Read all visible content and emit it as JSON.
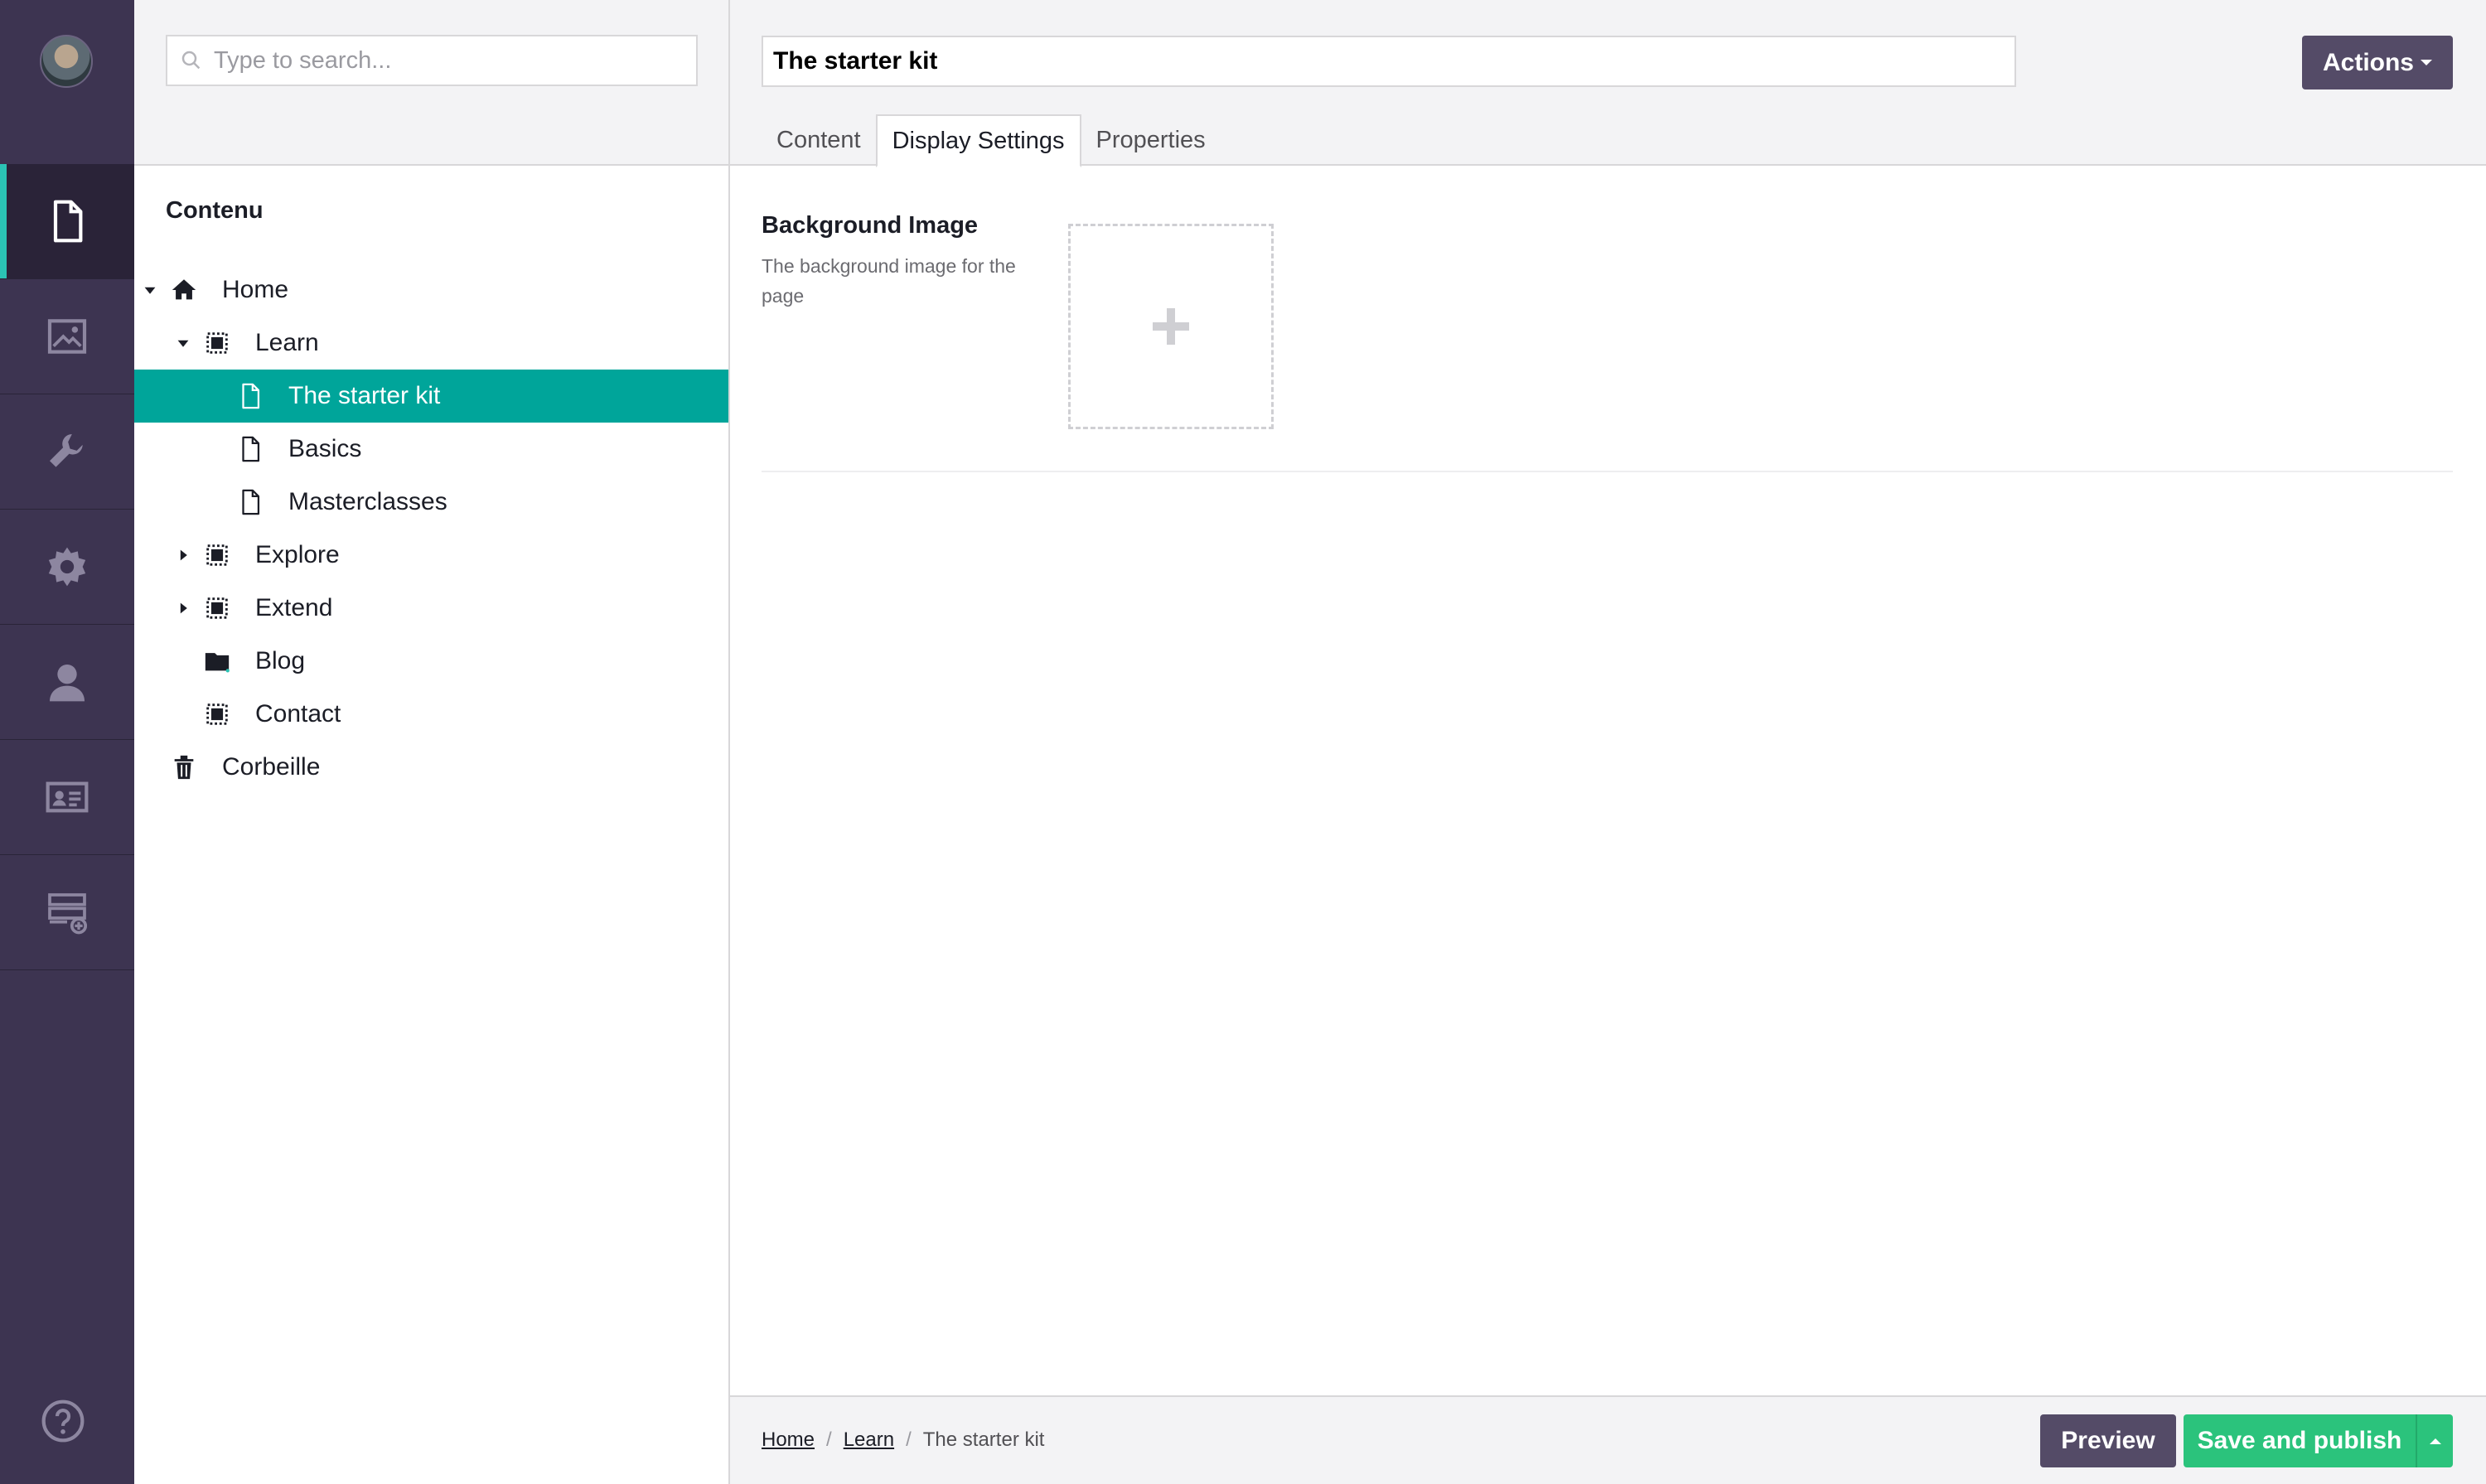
{
  "rail": {
    "sections": [
      {
        "name": "content",
        "icon": "document-icon",
        "active": true
      },
      {
        "name": "media",
        "icon": "image-icon",
        "active": false
      },
      {
        "name": "settings",
        "icon": "wrench-icon",
        "active": false
      },
      {
        "name": "packages",
        "icon": "gear-icon",
        "active": false
      },
      {
        "name": "users",
        "icon": "user-icon",
        "active": false
      },
      {
        "name": "members",
        "icon": "id-card-icon",
        "active": false
      },
      {
        "name": "forms",
        "icon": "forms-icon",
        "active": false
      }
    ],
    "help_icon": "help-icon",
    "accent": "#2bc3b4",
    "background": "#3d3451"
  },
  "tree": {
    "search_placeholder": "Type to search...",
    "heading": "Contenu",
    "items": [
      {
        "label": "Home",
        "icon": "home-icon",
        "depth": 0,
        "caret": "expanded",
        "selected": false
      },
      {
        "label": "Learn",
        "icon": "section-icon",
        "depth": 1,
        "caret": "expanded",
        "selected": false
      },
      {
        "label": "The starter kit",
        "icon": "page-icon",
        "depth": 2,
        "caret": "none",
        "selected": true
      },
      {
        "label": "Basics",
        "icon": "page-icon",
        "depth": 2,
        "caret": "none",
        "selected": false
      },
      {
        "label": "Masterclasses",
        "icon": "page-icon",
        "depth": 2,
        "caret": "none",
        "selected": false
      },
      {
        "label": "Explore",
        "icon": "section-icon",
        "depth": 1,
        "caret": "collapsed",
        "selected": false
      },
      {
        "label": "Extend",
        "icon": "section-icon",
        "depth": 1,
        "caret": "collapsed",
        "selected": false
      },
      {
        "label": "Blog",
        "icon": "folder-icon",
        "depth": 1,
        "caret": "none",
        "selected": false
      },
      {
        "label": "Contact",
        "icon": "section-icon",
        "depth": 1,
        "caret": "none",
        "selected": false
      },
      {
        "label": "Corbeille",
        "icon": "trash-icon",
        "depth": 0,
        "caret": "none",
        "selected": false
      }
    ],
    "selected_color": "#00a59a"
  },
  "editor": {
    "name_value": "The starter kit",
    "actions_label": "Actions",
    "tabs": [
      {
        "label": "Content",
        "active": false
      },
      {
        "label": "Display Settings",
        "active": true
      },
      {
        "label": "Properties",
        "active": false
      }
    ],
    "property": {
      "label": "Background Image",
      "description": "The background image for the page"
    }
  },
  "footer": {
    "breadcrumb": [
      "Home",
      "Learn",
      "The starter kit"
    ],
    "preview_label": "Preview",
    "publish_label": "Save and publish",
    "publish_color": "#2bc37c",
    "preview_color": "#544b67"
  }
}
